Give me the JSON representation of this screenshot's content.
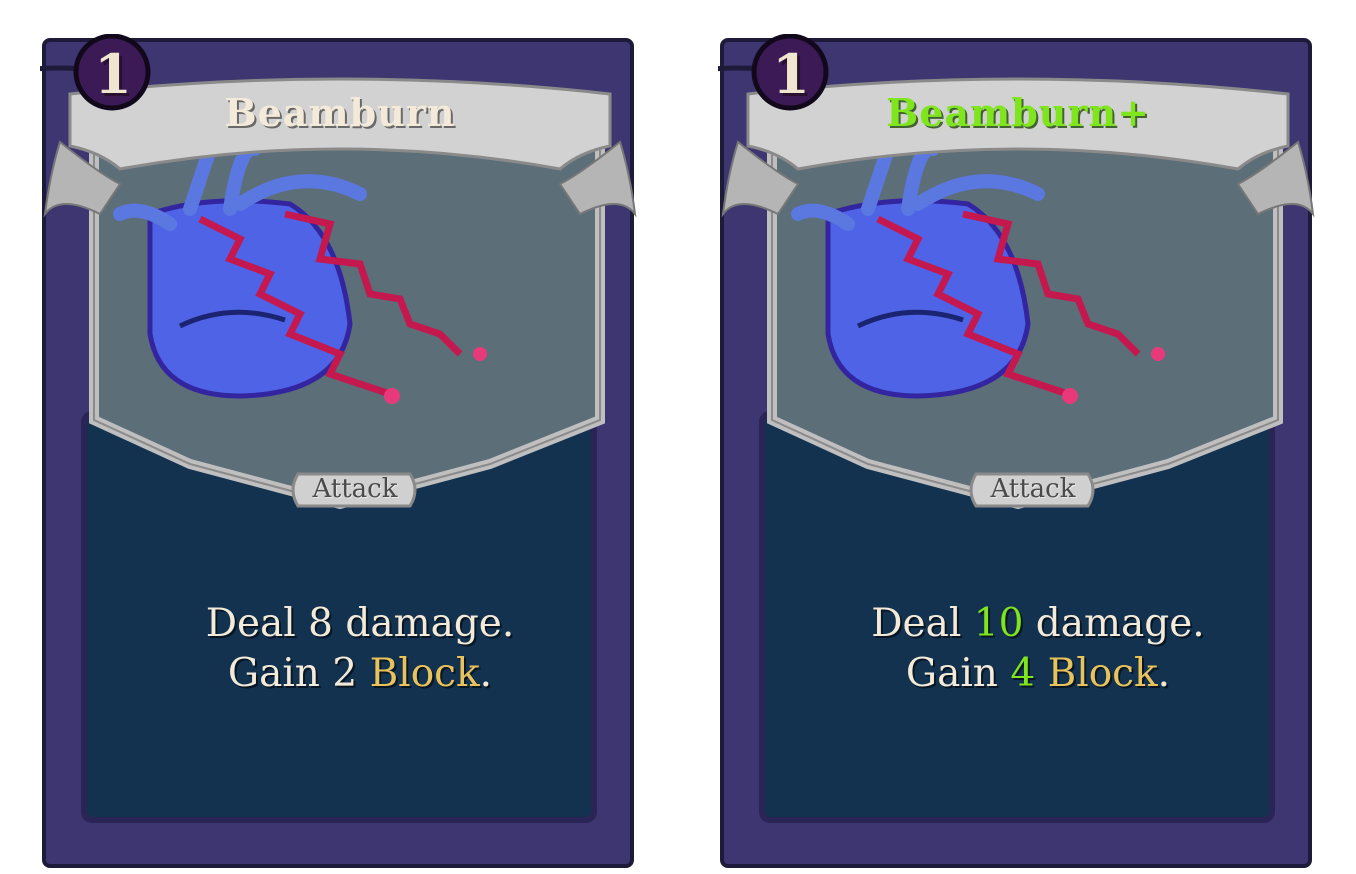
{
  "cards": [
    {
      "cost": "1",
      "name": "Beamburn",
      "type": "Attack",
      "line1": {
        "pre": "Deal ",
        "damage": "8",
        "post": " damage."
      },
      "line2": {
        "pre": "Gain ",
        "block": "2",
        "keyword": "Block",
        "post": "."
      }
    },
    {
      "cost": "1",
      "name": "Beamburn+",
      "type": "Attack",
      "line1": {
        "pre": "Deal ",
        "damage": "10",
        "post": " damage."
      },
      "line2": {
        "pre": "Gain ",
        "block": "4",
        "keyword": "Block",
        "post": "."
      }
    }
  ],
  "colors": {
    "frame": "#3d3670",
    "description_panel": "#10304a",
    "art_background": "#5a6c75",
    "banner": "#c8c8c8",
    "keyword": "#e8c25a",
    "upgrade": "#7fe61e"
  }
}
